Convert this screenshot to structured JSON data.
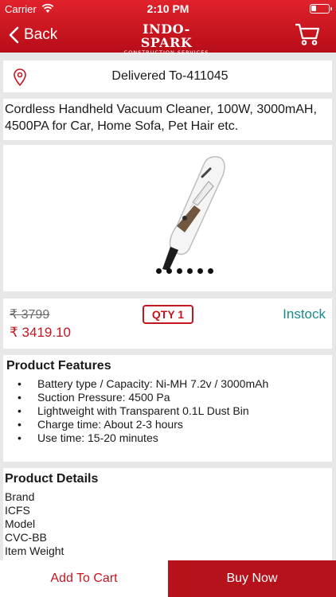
{
  "status": {
    "carrier": "Carrier",
    "time": "2:10 PM"
  },
  "nav": {
    "back_label": "Back",
    "logo_main": "INDO-SPARK",
    "logo_sub": "CONSTRUCTION SERVICES"
  },
  "delivery": {
    "text": "Delivered To-411045"
  },
  "product": {
    "title": "Cordless Handheld Vacuum Cleaner, 100W, 3000mAH, 4500PA for Car, Home Sofa, Pet Hair etc.",
    "gallery_dots": 6
  },
  "price": {
    "mrp": "₹ 3799",
    "sale": "₹ 3419.10",
    "qty_label": "QTY 1",
    "stock": "Instock"
  },
  "features": {
    "heading": "Product Features",
    "items": [
      "Battery type / Capacity: Ni-MH 7.2v / 3000mAh",
      "Suction Pressure: 4500 Pa",
      "Lightweight with Transparent 0.1L Dust Bin",
      "Charge time: About 2-3 hours",
      "Use time: 15-20 minutes"
    ]
  },
  "details": {
    "heading": "Product Details",
    "rows": [
      "Brand",
      "ICFS",
      "Model",
      "CVC-BB",
      "Item Weight"
    ]
  },
  "footer": {
    "add_to_cart": "Add To Cart",
    "buy_now": "Buy Now"
  },
  "colors": {
    "brand_red": "#c4161f",
    "stock_teal": "#1a8a8a"
  },
  "icons": [
    "wifi-icon",
    "battery-icon",
    "back-chevron-icon",
    "cart-icon",
    "location-pin-icon"
  ]
}
